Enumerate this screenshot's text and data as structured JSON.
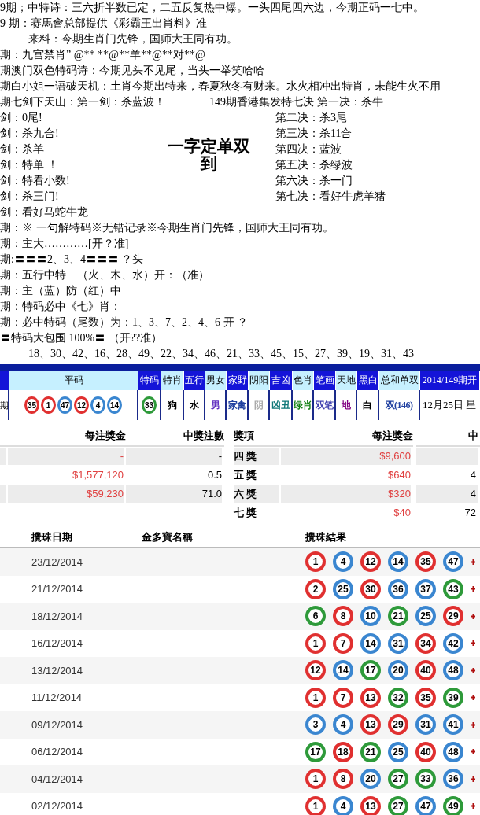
{
  "intro_lines": [
    {
      "kind": "plain",
      "text": "9期；中特诗：三六折半数已定，二五反复热中爆。一头四尾四六边，今期正码一七中。"
    },
    {
      "kind": "plain",
      "text": "9 期：赛馬會总部提供《彩霸王出肖料》准"
    },
    {
      "kind": "indented",
      "text": "来料：今期生肖门先锋，国师大王同有功。"
    },
    {
      "kind": "plain",
      "text": "期：九宫禁肖” @** **@**羊**@**对**@"
    },
    {
      "kind": "plain",
      "text": "期澳门双色特码诗：今期见头不见尾，当头一举笑哈哈"
    },
    {
      "kind": "plain",
      "text": "期白小姐一语破天机：土肖今期出特来，春夏秋冬有财来。水火相冲出特肖，未能生火不用"
    }
  ],
  "sword_block": {
    "title_left": "期七剑下天山：第一剑：杀蓝波！",
    "title_right": "149期香港集发特七决 第一决：杀牛",
    "left": [
      "剑：0尾!",
      "剑：杀九合!",
      "剑：杀羊",
      "剑：特单 ！",
      "剑：特看小数!",
      "剑：杀三门!",
      "剑：看好马蛇牛龙"
    ],
    "center": [
      "一字定单双",
      "到"
    ],
    "right": [
      "第二决：杀3尾",
      "第三决：杀11合",
      "第四决：蓝波",
      "第五决：杀绿波",
      "第六决：杀一门",
      "第七决：看好牛虎羊猪"
    ]
  },
  "outro_lines": [
    {
      "kind": "plain",
      "text": "期：※ 一句解特码※无错记录※今期生肖门先锋，国师大王同有功。"
    },
    {
      "kind": "plain",
      "text": "期：主大…………[开？准]"
    },
    {
      "kind": "plain",
      "text": "期:〓〓〓2、3、4〓〓〓 ？头"
    },
    {
      "kind": "plain",
      "text": "期：五行中特　（火、木、水）开：（准）"
    },
    {
      "kind": "plain",
      "text": "期：主（蓝）防（红）中"
    },
    {
      "kind": "plain",
      "text": "期：特码必中《七》肖："
    },
    {
      "kind": "plain",
      "text": "期：必中特码（尾数）为：1、3、7、2、4、6 开 ？"
    },
    {
      "kind": "plain",
      "text": "〓特码大包围 100%〓 （开??准）"
    },
    {
      "kind": "indented",
      "text": "18、30、42、16、28、49、22、34、46、21、33、45、15、27、39、19、31、43"
    }
  ],
  "draw_bar": {
    "headers": [
      {
        "text": "平码",
        "highlighted": true
      },
      {
        "text": "特码",
        "highlighted": false
      },
      {
        "text": "特肖",
        "highlighted": true
      },
      {
        "text": "五行",
        "highlighted": false
      },
      {
        "text": "男女",
        "highlighted": true
      },
      {
        "text": "家野",
        "highlighted": false
      },
      {
        "text": "阴阳",
        "highlighted": true
      },
      {
        "text": "吉凶",
        "highlighted": false
      },
      {
        "text": "色肖",
        "highlighted": true
      },
      {
        "text": "笔画",
        "highlighted": false
      },
      {
        "text": "天地",
        "highlighted": true
      },
      {
        "text": "黑白",
        "highlighted": false
      },
      {
        "text": "总和单双",
        "highlighted": true
      },
      {
        "text": "2014/149期开",
        "highlighted": false
      }
    ],
    "row_label": "期",
    "regular_balls": [
      {
        "number": "35",
        "color": "#e03030"
      },
      {
        "number": "1",
        "color": "#e03030"
      },
      {
        "number": "47",
        "color": "#3a86d0"
      },
      {
        "number": "12",
        "color": "#e03030"
      },
      {
        "number": "4",
        "color": "#3a86d0"
      },
      {
        "number": "14",
        "color": "#3a86d0"
      }
    ],
    "special_ball": {
      "number": "33",
      "color": "#2e9a3a"
    },
    "attributes": [
      {
        "text": "狗",
        "color": "#000000"
      },
      {
        "text": "水",
        "color": "#000000"
      },
      {
        "text": "男",
        "color": "#6030c0"
      },
      {
        "text": "家禽",
        "color": "#2040a0"
      },
      {
        "text": "阴",
        "color": "#aaaaaa"
      },
      {
        "text": "凶丑",
        "color": "#107878"
      },
      {
        "text": "绿肖",
        "color": "#108010"
      },
      {
        "text": "双笔",
        "color": "#4040b0"
      },
      {
        "text": "地",
        "color": "#800080"
      },
      {
        "text": "白",
        "color": "#000000"
      },
      {
        "text": "双(146)",
        "color": "#2040a0"
      }
    ],
    "date_text": "12月25日 星"
  },
  "prize_table": {
    "left_headers": [
      "每注獎金",
      "中獎注數"
    ],
    "left_rows": [
      {
        "amount": "-",
        "count": "-"
      },
      {
        "amount": "$1,577,120",
        "count": "0.5"
      },
      {
        "amount": "$59,230",
        "count": "71.0"
      }
    ],
    "right_headers": [
      "獎項",
      "每注獎金",
      "中"
    ],
    "right_rows": [
      {
        "name": "四 獎",
        "amount": "$9,600"
      },
      {
        "name": "五 獎",
        "amount": "$640",
        "count": "4"
      },
      {
        "name": "六 獎",
        "amount": "$320",
        "count": "4"
      },
      {
        "name": "七 獎",
        "amount": "$40",
        "count": "72"
      }
    ]
  },
  "results": {
    "headers": [
      "攪珠日期",
      "金多寶名稱",
      "攪珠結果"
    ],
    "rows": [
      {
        "date": "23/12/2014",
        "balls": [
          {
            "number": "1",
            "color": "#e03030"
          },
          {
            "number": "4",
            "color": "#3a86d0"
          },
          {
            "number": "12",
            "color": "#e03030"
          },
          {
            "number": "14",
            "color": "#3a86d0"
          },
          {
            "number": "35",
            "color": "#e03030"
          },
          {
            "number": "47",
            "color": "#3a86d0"
          }
        ]
      },
      {
        "date": "21/12/2014",
        "balls": [
          {
            "number": "2",
            "color": "#e03030"
          },
          {
            "number": "25",
            "color": "#3a86d0"
          },
          {
            "number": "30",
            "color": "#e03030"
          },
          {
            "number": "36",
            "color": "#3a86d0"
          },
          {
            "number": "37",
            "color": "#3a86d0"
          },
          {
            "number": "43",
            "color": "#2e9a3a"
          }
        ]
      },
      {
        "date": "18/12/2014",
        "balls": [
          {
            "number": "6",
            "color": "#2e9a3a"
          },
          {
            "number": "8",
            "color": "#e03030"
          },
          {
            "number": "10",
            "color": "#3a86d0"
          },
          {
            "number": "21",
            "color": "#2e9a3a"
          },
          {
            "number": "25",
            "color": "#3a86d0"
          },
          {
            "number": "29",
            "color": "#e03030"
          }
        ]
      },
      {
        "date": "16/12/2014",
        "balls": [
          {
            "number": "1",
            "color": "#e03030"
          },
          {
            "number": "7",
            "color": "#e03030"
          },
          {
            "number": "14",
            "color": "#3a86d0"
          },
          {
            "number": "31",
            "color": "#3a86d0"
          },
          {
            "number": "34",
            "color": "#e03030"
          },
          {
            "number": "42",
            "color": "#3a86d0"
          }
        ]
      },
      {
        "date": "13/12/2014",
        "balls": [
          {
            "number": "12",
            "color": "#e03030"
          },
          {
            "number": "14",
            "color": "#3a86d0"
          },
          {
            "number": "17",
            "color": "#2e9a3a"
          },
          {
            "number": "20",
            "color": "#3a86d0"
          },
          {
            "number": "40",
            "color": "#e03030"
          },
          {
            "number": "48",
            "color": "#3a86d0"
          }
        ]
      },
      {
        "date": "11/12/2014",
        "balls": [
          {
            "number": "1",
            "color": "#e03030"
          },
          {
            "number": "7",
            "color": "#e03030"
          },
          {
            "number": "13",
            "color": "#e03030"
          },
          {
            "number": "32",
            "color": "#2e9a3a"
          },
          {
            "number": "35",
            "color": "#e03030"
          },
          {
            "number": "39",
            "color": "#2e9a3a"
          }
        ]
      },
      {
        "date": "09/12/2014",
        "balls": [
          {
            "number": "3",
            "color": "#3a86d0"
          },
          {
            "number": "4",
            "color": "#3a86d0"
          },
          {
            "number": "13",
            "color": "#e03030"
          },
          {
            "number": "29",
            "color": "#e03030"
          },
          {
            "number": "31",
            "color": "#3a86d0"
          },
          {
            "number": "41",
            "color": "#3a86d0"
          }
        ]
      },
      {
        "date": "06/12/2014",
        "balls": [
          {
            "number": "17",
            "color": "#2e9a3a"
          },
          {
            "number": "18",
            "color": "#e03030"
          },
          {
            "number": "21",
            "color": "#2e9a3a"
          },
          {
            "number": "25",
            "color": "#3a86d0"
          },
          {
            "number": "40",
            "color": "#e03030"
          },
          {
            "number": "48",
            "color": "#3a86d0"
          }
        ]
      },
      {
        "date": "04/12/2014",
        "balls": [
          {
            "number": "1",
            "color": "#e03030"
          },
          {
            "number": "8",
            "color": "#e03030"
          },
          {
            "number": "20",
            "color": "#3a86d0"
          },
          {
            "number": "27",
            "color": "#2e9a3a"
          },
          {
            "number": "33",
            "color": "#2e9a3a"
          },
          {
            "number": "36",
            "color": "#3a86d0"
          }
        ]
      },
      {
        "date": "02/12/2014",
        "balls": [
          {
            "number": "1",
            "color": "#e03030"
          },
          {
            "number": "4",
            "color": "#3a86d0"
          },
          {
            "number": "13",
            "color": "#e03030"
          },
          {
            "number": "27",
            "color": "#2e9a3a"
          },
          {
            "number": "47",
            "color": "#3a86d0"
          },
          {
            "number": "49",
            "color": "#2e9a3a"
          }
        ]
      }
    ]
  }
}
